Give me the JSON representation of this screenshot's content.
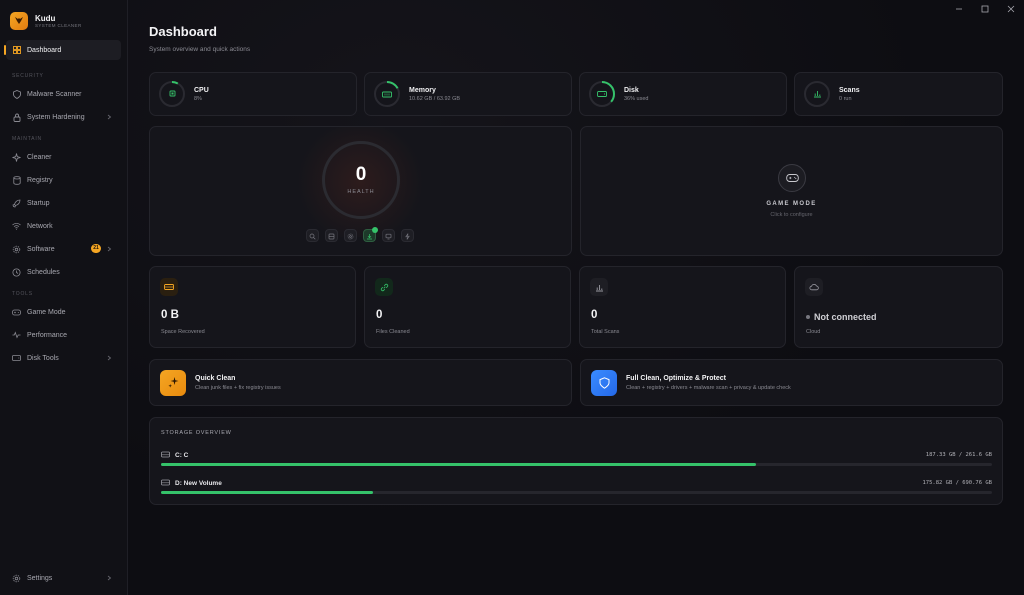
{
  "brand": {
    "name": "Kudu",
    "subtitle": "SYSTEM CLEANER"
  },
  "nav": {
    "dashboard": "Dashboard",
    "sections": {
      "security": "SECURITY",
      "maintain": "MAINTAIN",
      "tools": "TOOLS"
    },
    "items": {
      "malware_scanner": "Malware Scanner",
      "system_hardening": "System Hardening",
      "cleaner": "Cleaner",
      "registry": "Registry",
      "startup": "Startup",
      "network": "Network",
      "software": "Software",
      "software_badge": "21",
      "schedules": "Schedules",
      "game_mode": "Game Mode",
      "performance": "Performance",
      "disk_tools": "Disk Tools"
    },
    "settings": "Settings"
  },
  "header": {
    "title": "Dashboard",
    "subtitle": "System overview and quick actions"
  },
  "stats": {
    "cpu": {
      "name": "CPU",
      "value": "8%",
      "fraction": 0.08
    },
    "memory": {
      "name": "Memory",
      "value": "10.62 GB / 63.92 GB",
      "fraction": 0.17
    },
    "disk": {
      "name": "Disk",
      "value": "36% used",
      "fraction": 0.36
    },
    "scans": {
      "name": "Scans",
      "value": "0 run",
      "fraction": 0
    }
  },
  "health": {
    "value": "0",
    "label": "HEALTH"
  },
  "game_mode": {
    "title": "GAME MODE",
    "subtitle": "Click to configure"
  },
  "metrics": {
    "space": {
      "value": "0 B",
      "label": "Space Recovered"
    },
    "files": {
      "value": "0",
      "label": "Files Cleaned"
    },
    "scans": {
      "value": "0",
      "label": "Total Scans"
    },
    "cloud": {
      "status": "Not connected",
      "label": "Cloud"
    }
  },
  "actions": {
    "quick": {
      "title": "Quick Clean",
      "subtitle": "Clean junk files + fix registry issues"
    },
    "full": {
      "title": "Full Clean, Optimize & Protect",
      "subtitle": "Clean + registry + drivers + malware scan + privacy & update check"
    }
  },
  "storage": {
    "title": "STORAGE OVERVIEW",
    "drives": [
      {
        "name": "C: C",
        "size": "187.33 GB / 261.6 GB",
        "fraction": 0.716
      },
      {
        "name": "D: New Volume",
        "size": "175.82 GB / 690.76 GB",
        "fraction": 0.255
      }
    ]
  },
  "colors": {
    "accent": "#f5a623",
    "success": "#35c26a",
    "primary": "#2f7df6"
  }
}
